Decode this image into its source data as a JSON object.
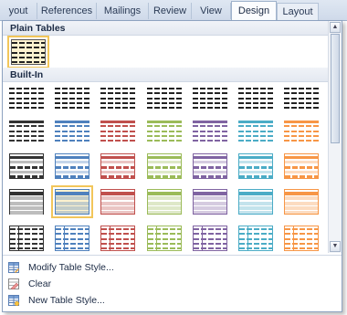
{
  "tabs": [
    {
      "label": "yout"
    },
    {
      "label": "References"
    },
    {
      "label": "Mailings"
    },
    {
      "label": "Review"
    },
    {
      "label": "View"
    },
    {
      "label": "Design"
    },
    {
      "label": "Layout"
    }
  ],
  "gallery": {
    "plain_tables_header": "Plain Tables",
    "built_in_header": "Built-In"
  },
  "menu": {
    "modify": "Modify Table Style...",
    "clear": "Clear",
    "new": "New Table Style..."
  },
  "style_colors": [
    "#333333",
    "#4f81bd",
    "#c0504d",
    "#9bbb59",
    "#8064a2",
    "#4bacc6",
    "#f79646"
  ],
  "selected_style": {
    "row": 3,
    "col": 1
  }
}
